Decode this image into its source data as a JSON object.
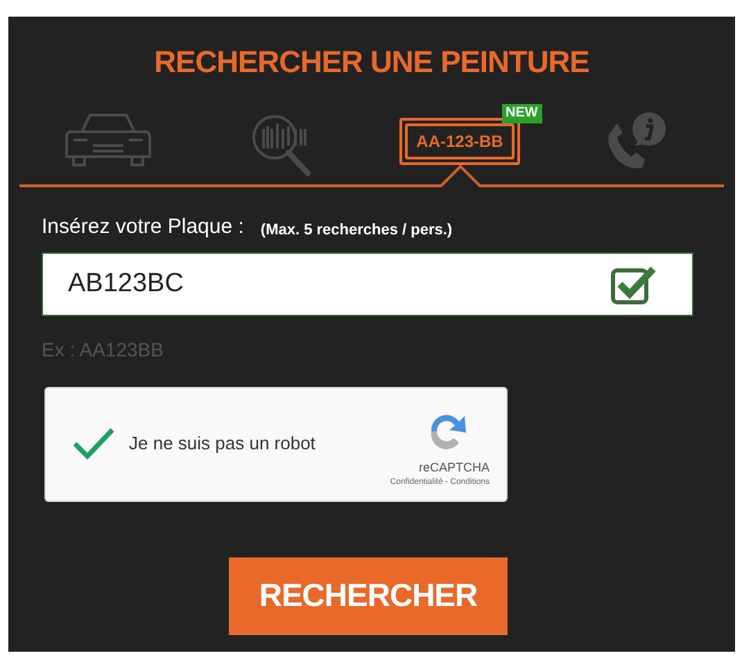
{
  "title": "RECHERCHER UNE PEINTURE",
  "tabs": [
    {
      "kind": "car",
      "selected": false
    },
    {
      "kind": "vin",
      "selected": false
    },
    {
      "kind": "plate",
      "selected": true,
      "text": "AA-123-BB",
      "badge": "NEW"
    },
    {
      "kind": "contact",
      "selected": false
    }
  ],
  "form": {
    "label": "Insérez votre Plaque :",
    "limit": "(Max. 5 recherches / pers.)",
    "value": "AB123BC",
    "valid": true,
    "example": "Ex : AA123BB"
  },
  "captcha": {
    "checked": true,
    "label": "Je ne suis pas un robot",
    "brand": "reCAPTCHA",
    "links": "Confidentialité - Conditions"
  },
  "button": "RECHERCHER"
}
